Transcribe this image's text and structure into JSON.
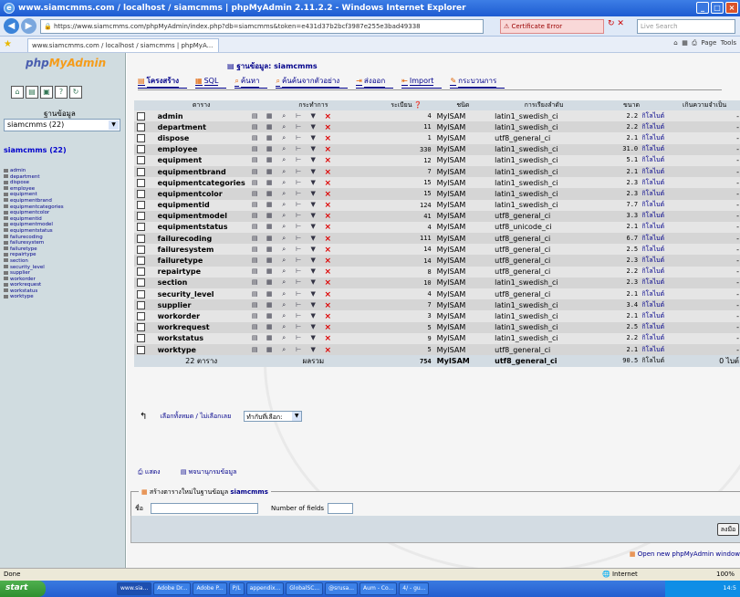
{
  "window": {
    "title": "www.siamcmms.com / localhost / siamcmms | phpMyAdmin 2.11.2.2 - Windows Internet Explorer"
  },
  "addressbar": {
    "url": "https://www.siamcmms.com/phpMyAdmin/index.php?db=siamcmms&token=e431d37b2bcf3987e255e3bad49338",
    "cert_error": "Certificate Error",
    "search_placeholder": "Live Search"
  },
  "tabbar": {
    "tab_title": "www.siamcmms.com / localhost / siamcmms | phpMyA...",
    "page_menu": "Page",
    "tools_menu": "Tools"
  },
  "sidebar": {
    "logo_text": "php",
    "logo_accent": "MyAdmin",
    "db_label": "ฐานข้อมูล",
    "db_selected": "siamcmms (22)",
    "db_name": "siamcmms (22)",
    "tables": [
      "admin",
      "department",
      "dispose",
      "employee",
      "equipment",
      "equipmentbrand",
      "equipmentcategories",
      "equipmentcolor",
      "equipmentid",
      "equipmentmodel",
      "equipmentstatus",
      "failurecoding",
      "failuresystem",
      "failuretype",
      "repairtype",
      "section",
      "security_level",
      "supplier",
      "workorder",
      "workrequest",
      "workstatus",
      "worktype"
    ]
  },
  "main": {
    "breadcrumb": "ฐานข้อมูล: siamcmms",
    "tabs": [
      {
        "label": "โครงสร้าง",
        "active": true
      },
      {
        "label": "SQL",
        "active": false
      },
      {
        "label": "ค้นหา",
        "active": false
      },
      {
        "label": "ค้นค้นจากตัวอย่าง",
        "active": false
      },
      {
        "label": "ส่งออก",
        "active": false
      },
      {
        "label": "Import",
        "active": false
      },
      {
        "label": "กระบวนการ",
        "active": false
      }
    ],
    "columns": [
      "ตาราง",
      "กระทำการ",
      "ระเบียน",
      "ชนิด",
      "การเรียงลำดับ",
      "ขนาด",
      "เกินความจำเป็น"
    ],
    "size_unit": "กิโลไบต์",
    "rows": [
      {
        "name": "admin",
        "records": "4",
        "type": "MyISAM",
        "collation": "latin1_swedish_ci",
        "size": "2.2",
        "overhead": "-"
      },
      {
        "name": "department",
        "records": "11",
        "type": "MyISAM",
        "collation": "latin1_swedish_ci",
        "size": "2.2",
        "overhead": "-"
      },
      {
        "name": "dispose",
        "records": "1",
        "type": "MyISAM",
        "collation": "utf8_general_ci",
        "size": "2.1",
        "overhead": "-"
      },
      {
        "name": "employee",
        "records": "330",
        "type": "MyISAM",
        "collation": "latin1_swedish_ci",
        "size": "31.0",
        "overhead": "-"
      },
      {
        "name": "equipment",
        "records": "12",
        "type": "MyISAM",
        "collation": "latin1_swedish_ci",
        "size": "5.1",
        "overhead": "-"
      },
      {
        "name": "equipmentbrand",
        "records": "7",
        "type": "MyISAM",
        "collation": "latin1_swedish_ci",
        "size": "2.1",
        "overhead": "-"
      },
      {
        "name": "equipmentcategories",
        "records": "15",
        "type": "MyISAM",
        "collation": "latin1_swedish_ci",
        "size": "2.3",
        "overhead": "-"
      },
      {
        "name": "equipmentcolor",
        "records": "15",
        "type": "MyISAM",
        "collation": "latin1_swedish_ci",
        "size": "2.3",
        "overhead": "-"
      },
      {
        "name": "equipmentid",
        "records": "124",
        "type": "MyISAM",
        "collation": "latin1_swedish_ci",
        "size": "7.7",
        "overhead": "-"
      },
      {
        "name": "equipmentmodel",
        "records": "41",
        "type": "MyISAM",
        "collation": "utf8_general_ci",
        "size": "3.3",
        "overhead": "-"
      },
      {
        "name": "equipmentstatus",
        "records": "4",
        "type": "MyISAM",
        "collation": "utf8_unicode_ci",
        "size": "2.1",
        "overhead": "-"
      },
      {
        "name": "failurecoding",
        "records": "111",
        "type": "MyISAM",
        "collation": "utf8_general_ci",
        "size": "6.7",
        "overhead": "-"
      },
      {
        "name": "failuresystem",
        "records": "14",
        "type": "MyISAM",
        "collation": "utf8_general_ci",
        "size": "2.5",
        "overhead": "-"
      },
      {
        "name": "failuretype",
        "records": "14",
        "type": "MyISAM",
        "collation": "utf8_general_ci",
        "size": "2.3",
        "overhead": "-"
      },
      {
        "name": "repairtype",
        "records": "8",
        "type": "MyISAM",
        "collation": "utf8_general_ci",
        "size": "2.2",
        "overhead": "-"
      },
      {
        "name": "section",
        "records": "10",
        "type": "MyISAM",
        "collation": "latin1_swedish_ci",
        "size": "2.3",
        "overhead": "-"
      },
      {
        "name": "security_level",
        "records": "4",
        "type": "MyISAM",
        "collation": "utf8_general_ci",
        "size": "2.1",
        "overhead": "-"
      },
      {
        "name": "supplier",
        "records": "7",
        "type": "MyISAM",
        "collation": "latin1_swedish_ci",
        "size": "3.4",
        "overhead": "-"
      },
      {
        "name": "workorder",
        "records": "3",
        "type": "MyISAM",
        "collation": "latin1_swedish_ci",
        "size": "2.1",
        "overhead": "-"
      },
      {
        "name": "workrequest",
        "records": "5",
        "type": "MyISAM",
        "collation": "latin1_swedish_ci",
        "size": "2.5",
        "overhead": "-"
      },
      {
        "name": "workstatus",
        "records": "9",
        "type": "MyISAM",
        "collation": "latin1_swedish_ci",
        "size": "2.2",
        "overhead": "-"
      },
      {
        "name": "worktype",
        "records": "5",
        "type": "MyISAM",
        "collation": "utf8_general_ci",
        "size": "2.1",
        "overhead": "-"
      }
    ],
    "summary": {
      "tables": "22 ตาราง",
      "label": "ผลรวม",
      "records": "754",
      "type": "MyISAM",
      "collation": "utf8_general_ci",
      "size": "90.5 กิโลไบต์",
      "overhead": "0 ไบต์"
    },
    "check_all": "เลือกทั้งหมด / ไม่เลือกเลย",
    "with_selected": "ทำกับที่เลือก:",
    "links": [
      "แสดง",
      "พจนานุกรมข้อมูล"
    ],
    "create_table": {
      "legend_prefix": "สร้างตารางใหม่ในฐานข้อมูล",
      "db": "siamcmms",
      "name_label": "ชื่อ",
      "fields_label": "Number of fields",
      "go_button": "ลงมือ"
    },
    "new_window_link": "Open new phpMyAdmin window"
  },
  "statusbar": {
    "left": "Done",
    "zone": "Internet",
    "zoom": "100%"
  },
  "taskbar": {
    "start": "start",
    "tasks": [
      "www.sia...",
      "Adobe Dr...",
      "Adobe P...",
      "P/L",
      "appendix...",
      "GlobalSC...",
      "@srusa...",
      "Aum - Co...",
      "4/ - gu..."
    ],
    "clock": "14:5"
  }
}
